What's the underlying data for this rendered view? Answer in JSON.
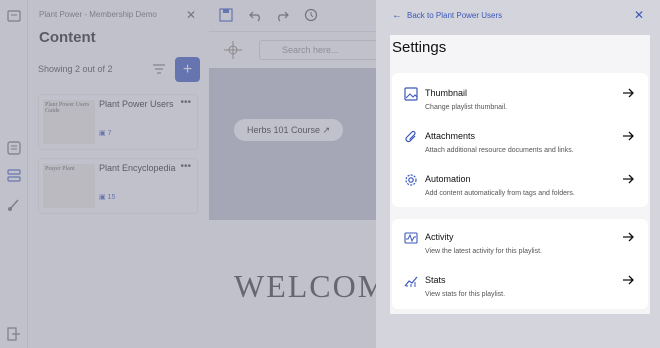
{
  "app": {
    "header_title": "Plant Power - Membership Demo",
    "panel_title": "Content",
    "showing_text": "Showing 2 out of 2",
    "add_label": "+",
    "cards": [
      {
        "name": "Plant Power Users",
        "count": "7",
        "thumb_text": "Plant Power Users Guide"
      },
      {
        "name": "Plant Encyclopedia",
        "count": "15",
        "thumb_text": "Prayer Plant"
      }
    ],
    "search_placeholder": "Search here...",
    "hero_button": "Herbs 101 Course ↗",
    "welcome_text": "WELCOM"
  },
  "drawer": {
    "back_label": "Back to Plant Power Users",
    "title": "Settings",
    "groups": [
      {
        "items": [
          {
            "title": "Thumbnail",
            "desc": "Change playlist thumbnail.",
            "icon": "image-icon"
          },
          {
            "title": "Attachments",
            "desc": "Attach additional resource documents and links.",
            "icon": "paperclip-icon"
          },
          {
            "title": "Automation",
            "desc": "Add content automatically from tags and folders.",
            "icon": "gear-icon"
          }
        ]
      },
      {
        "items": [
          {
            "title": "Activity",
            "desc": "View the latest activity for this playlist.",
            "icon": "activity-icon"
          },
          {
            "title": "Stats",
            "desc": "View stats for this playlist.",
            "icon": "stats-icon"
          }
        ]
      }
    ]
  },
  "colors": {
    "accent": "#3b57b8",
    "add_button": "#4a66c9",
    "overlay": "#82849680"
  }
}
